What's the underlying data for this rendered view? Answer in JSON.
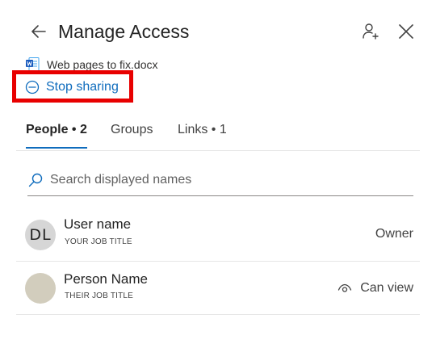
{
  "header": {
    "title": "Manage Access",
    "back_icon": "arrow-left-icon",
    "add_person_icon": "person-add-icon",
    "close_icon": "close-icon"
  },
  "file": {
    "icon": "word-document-icon",
    "name": "Web pages to fix.docx"
  },
  "stop_sharing": {
    "icon": "minus-circle-icon",
    "label": "Stop sharing",
    "highlight_color": "#e80000"
  },
  "tabs": [
    {
      "label": "People • 2",
      "active": true
    },
    {
      "label": "Groups",
      "active": false
    },
    {
      "label": "Links • 1",
      "active": false
    }
  ],
  "search": {
    "icon": "search-icon",
    "placeholder": "Search displayed names",
    "value": ""
  },
  "people": [
    {
      "initials": "DL",
      "name": "User name",
      "title": "YOUR JOB TITLE",
      "role": "Owner",
      "role_icon": ""
    },
    {
      "initials": "",
      "name": "Person Name",
      "title": "THEIR JOB TITLE",
      "role": "Can view",
      "role_icon": "eye-icon"
    }
  ],
  "colors": {
    "accent": "#0f6cbd",
    "highlight_box": "#e80000",
    "avatar_gray": "#d6d6d6",
    "avatar_beige": "#d2cdbd"
  }
}
